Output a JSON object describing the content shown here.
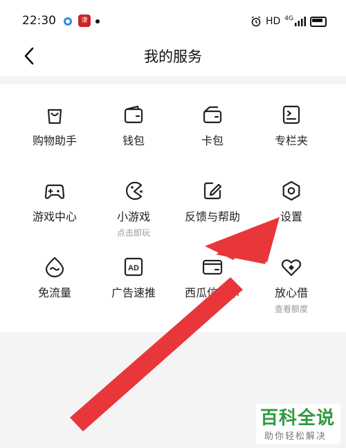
{
  "status_bar": {
    "time": "22:30",
    "app_badge_text": "津",
    "right_text": "HD",
    "network": "4G"
  },
  "header": {
    "title": "我的服务"
  },
  "services": [
    {
      "label": "购物助手",
      "icon": "shopping-bag-icon"
    },
    {
      "label": "钱包",
      "icon": "wallet-icon"
    },
    {
      "label": "卡包",
      "icon": "card-holder-icon"
    },
    {
      "label": "专栏夹",
      "icon": "column-folder-icon"
    },
    {
      "label": "游戏中心",
      "icon": "gamepad-icon"
    },
    {
      "label": "小游戏",
      "sub": "点击即玩",
      "icon": "pacman-icon"
    },
    {
      "label": "反馈与帮助",
      "icon": "feedback-edit-icon"
    },
    {
      "label": "设置",
      "icon": "settings-hexagon-icon"
    },
    {
      "label": "免流量",
      "icon": "free-data-drop-icon"
    },
    {
      "label": "广告速推",
      "icon": "ad-icon"
    },
    {
      "label": "西瓜信用卡",
      "icon": "credit-card-icon"
    },
    {
      "label": "放心借",
      "sub": "查看额度",
      "icon": "heart-diamond-icon"
    }
  ],
  "annotation": {
    "arrow_color": "#e8363a",
    "arrow_target": "设置"
  },
  "watermark": {
    "main": "百科全说",
    "sub": "助你轻松解决"
  }
}
